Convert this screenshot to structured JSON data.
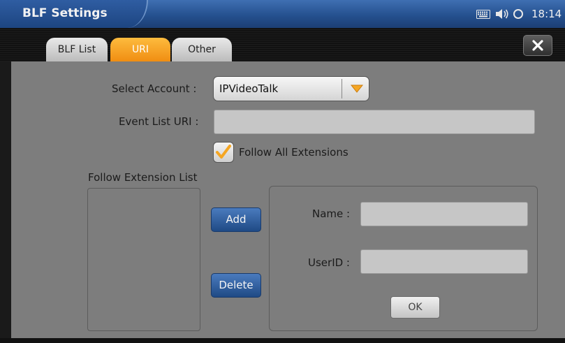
{
  "window": {
    "title": "BLF Settings"
  },
  "status": {
    "time": "18:14"
  },
  "tabs": [
    {
      "label": "BLF List",
      "active": false
    },
    {
      "label": "URI",
      "active": true
    },
    {
      "label": "Other",
      "active": false
    }
  ],
  "form": {
    "select_account_label": "Select Account :",
    "select_account_value": "IPVideoTalk",
    "event_list_uri_label": "Event List URI :",
    "event_list_uri_value": "",
    "follow_all_label": "Follow All Extensions",
    "follow_all_checked": true,
    "follow_list_label": "Follow Extension List",
    "add_label": "Add",
    "delete_label": "Delete",
    "name_label": "Name :",
    "name_value": "",
    "userid_label": "UserID :",
    "userid_value": "",
    "ok_label": "OK"
  },
  "colors": {
    "accent_orange": "#f5a623",
    "title_blue": "#25518f",
    "panel_gray": "#7d7d7d",
    "button_blue": "#2e5fa0"
  },
  "icons": [
    "keyboard-icon",
    "volume-icon",
    "sync-icon",
    "close-icon",
    "dropdown-arrow-icon",
    "checkmark-icon"
  ]
}
